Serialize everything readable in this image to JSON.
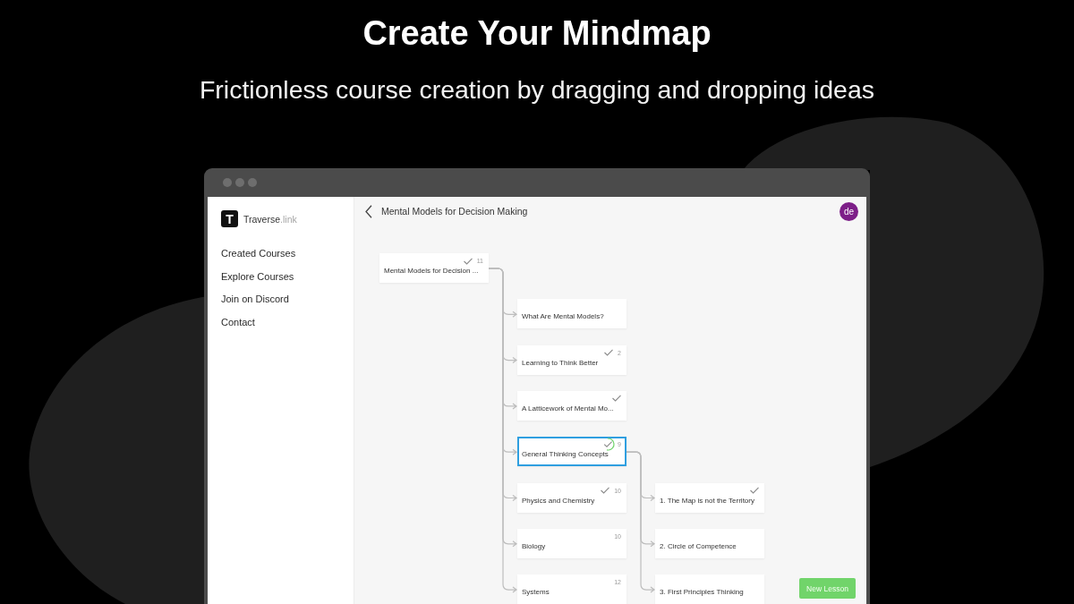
{
  "heading": {
    "title": "Create Your Mindmap",
    "subtitle": "Frictionless course creation by dragging and dropping ideas"
  },
  "app": {
    "brand": {
      "mark": "T",
      "name": "Traverse",
      "domain": ".link"
    },
    "nav": [
      "Created Courses",
      "Explore Courses",
      "Join on Discord",
      "Contact"
    ],
    "header": {
      "title": "Mental Models for Decision Making",
      "avatar": "de"
    },
    "mindmap": {
      "root": {
        "title": "Mental Models for Decision ...",
        "count": "11",
        "checked": true,
        "selected": false,
        "in_progress": false,
        "children": [
          {
            "title": "What Are Mental Models?",
            "checked": false,
            "selected": false,
            "in_progress": false
          },
          {
            "title": "Learning to Think Better",
            "count": "2",
            "checked": true,
            "selected": false,
            "in_progress": false
          },
          {
            "title": "A Latticework of Mental Mo...",
            "checked": true,
            "selected": false,
            "in_progress": false
          },
          {
            "title": "General Thinking Concepts",
            "count": "9",
            "checked": true,
            "selected": true,
            "in_progress": true,
            "children": [
              {
                "title": "1. The Map is not the Territory",
                "checked": true,
                "selected": false,
                "in_progress": false
              },
              {
                "title": "2. Circle of Competence",
                "checked": false,
                "selected": false,
                "in_progress": false
              },
              {
                "title": "3. First Principles Thinking",
                "checked": false,
                "selected": false,
                "in_progress": false
              }
            ]
          },
          {
            "title": "Physics and Chemistry",
            "count": "10",
            "checked": true,
            "selected": false,
            "in_progress": false
          },
          {
            "title": "Biology",
            "count": "10",
            "checked": false,
            "selected": false,
            "in_progress": false
          },
          {
            "title": "Systems",
            "count": "12",
            "checked": false,
            "selected": false,
            "in_progress": false
          }
        ]
      }
    },
    "new_lesson_button": "New Lesson"
  }
}
